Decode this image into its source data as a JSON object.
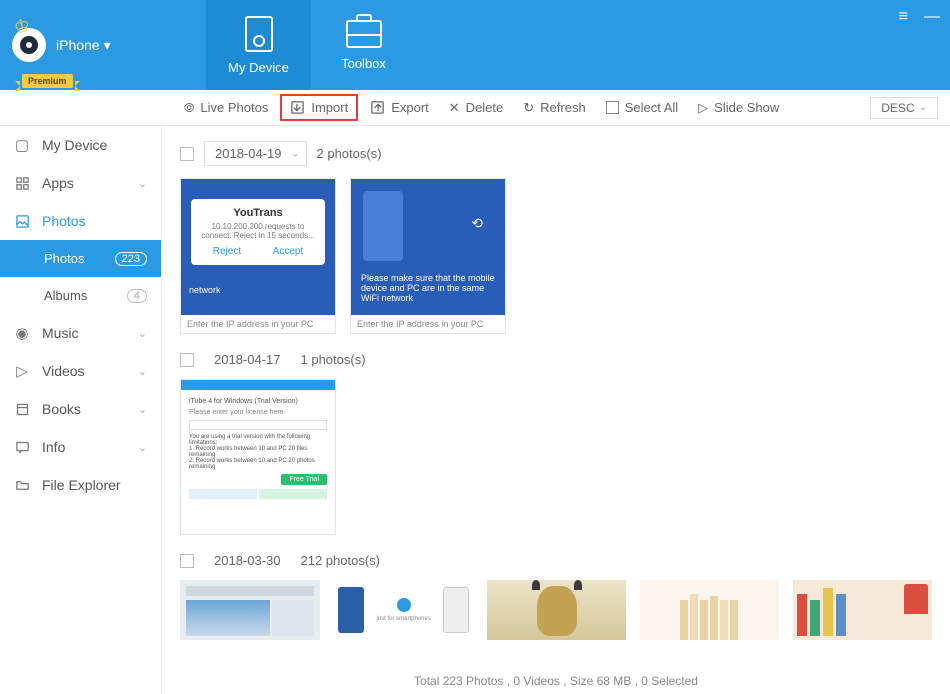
{
  "header": {
    "device_name": "iPhone",
    "premium_label": "Premium",
    "tabs": [
      {
        "id": "my-device",
        "label": "My Device",
        "active": true
      },
      {
        "id": "toolbox",
        "label": "Toolbox",
        "active": false
      }
    ]
  },
  "toolbar": {
    "live_photos": "Live Photos",
    "import": "Import",
    "export": "Export",
    "delete": "Delete",
    "refresh": "Refresh",
    "select_all": "Select All",
    "slide_show": "Slide Show",
    "sort": "DESC"
  },
  "sidebar": {
    "items": [
      {
        "id": "my-device",
        "label": "My Device",
        "icon": "device"
      },
      {
        "id": "apps",
        "label": "Apps",
        "icon": "grid",
        "expandable": true
      },
      {
        "id": "photos",
        "label": "Photos",
        "icon": "image",
        "active": true,
        "expandable": true,
        "children": [
          {
            "id": "photos-sub",
            "label": "Photos",
            "count": "223",
            "highlight": true
          },
          {
            "id": "albums",
            "label": "Albums",
            "count": "4"
          }
        ]
      },
      {
        "id": "music",
        "label": "Music",
        "icon": "music",
        "expandable": true
      },
      {
        "id": "videos",
        "label": "Videos",
        "icon": "play",
        "expandable": true
      },
      {
        "id": "books",
        "label": "Books",
        "icon": "book",
        "expandable": true
      },
      {
        "id": "info",
        "label": "Info",
        "icon": "chat",
        "expandable": true
      },
      {
        "id": "file-explorer",
        "label": "File Explorer",
        "icon": "folder"
      }
    ]
  },
  "content": {
    "groups": [
      {
        "date": "2018-04-19",
        "count_label": "2 photos(s)",
        "has_dropdown": true
      },
      {
        "date": "2018-04-17",
        "count_label": "1 photos(s)"
      },
      {
        "date": "2018-03-30",
        "count_label": "212 photos(s)"
      }
    ],
    "thumb_texts": {
      "youtrans_title": "YouTrans",
      "youtrans_body": "10.10.200.200 requests to connect. Reject in 15 seconds...",
      "reject": "Reject",
      "accept": "Accept",
      "wifi_msg": "Please make sure that the mobile device and PC are in the same WiFi network",
      "enter_ip": "Enter the IP address in your PC"
    }
  },
  "status_bar": "Total 223 Photos , 0 Videos , Size 68 MB , 0 Selected"
}
